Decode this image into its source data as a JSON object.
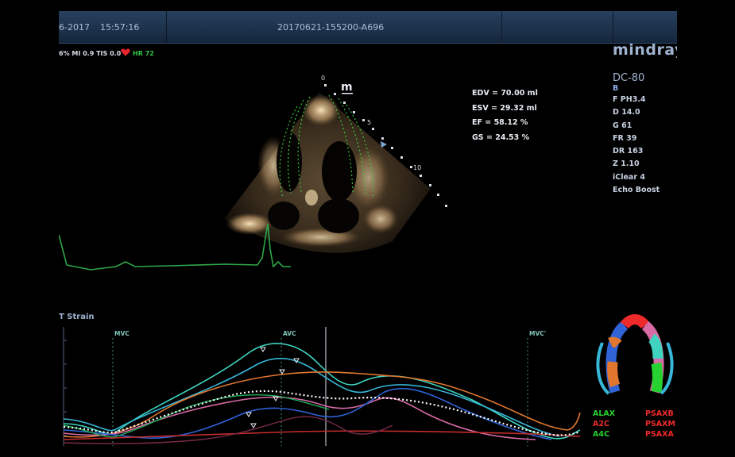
{
  "topbar": {
    "date": "6-2017",
    "time": "15:57:16",
    "exam_id": "20170621-155200-A696",
    "field_right_1": "",
    "field_right_2": ""
  },
  "acquisition": {
    "prefix": "6%",
    "mi": "MI 0.9",
    "tis": "TIS 0.0",
    "hr": "HR 72"
  },
  "brand": {
    "logo": "mindray",
    "probe_marker": "m"
  },
  "scale_marks": [
    "0",
    "5",
    "10"
  ],
  "measurements": [
    {
      "label": "EDV",
      "value": "= 70.00 ml"
    },
    {
      "label": "ESV",
      "value": "= 29.32 ml"
    },
    {
      "label": "EF",
      "value": "= 58.12 %"
    },
    {
      "label": "GS",
      "value": "= 24.53 %"
    }
  ],
  "system_params": {
    "model": "DC-80",
    "mode": "B",
    "lines": [
      "F PH3.4",
      "D 14.0",
      "G 61",
      "FR 39",
      "DR 163",
      "Z 1.10",
      "iClear 4",
      "Echo Boost"
    ]
  },
  "strain_panel": {
    "title": "T Strain",
    "markers": [
      "MVC",
      "AVC",
      "MVC'"
    ]
  },
  "legend": {
    "left": [
      {
        "text": "ALAX",
        "color": "#27d12f"
      },
      {
        "text": "A2C",
        "color": "#ee2a2a"
      },
      {
        "text": "A4C",
        "color": "#27d12f"
      }
    ],
    "right": [
      {
        "text": "PSAXB",
        "color": "#ee2a2a"
      },
      {
        "text": "PSAXM",
        "color": "#ee2a2a"
      },
      {
        "text": "PSAXA",
        "color": "#ee2a2a"
      }
    ]
  },
  "colors": {
    "ecg": "#2fa84a",
    "tracking": "#39c83a",
    "curve_teal": "#3fd4c0",
    "curve_cyan": "#38b7d9",
    "curve_orange": "#e0772e",
    "curve_pink": "#d86aa6",
    "curve_blue": "#2f63d6",
    "curve_red": "#c42c2c",
    "curve_green": "#1fae5a",
    "average": "#ffffff"
  }
}
